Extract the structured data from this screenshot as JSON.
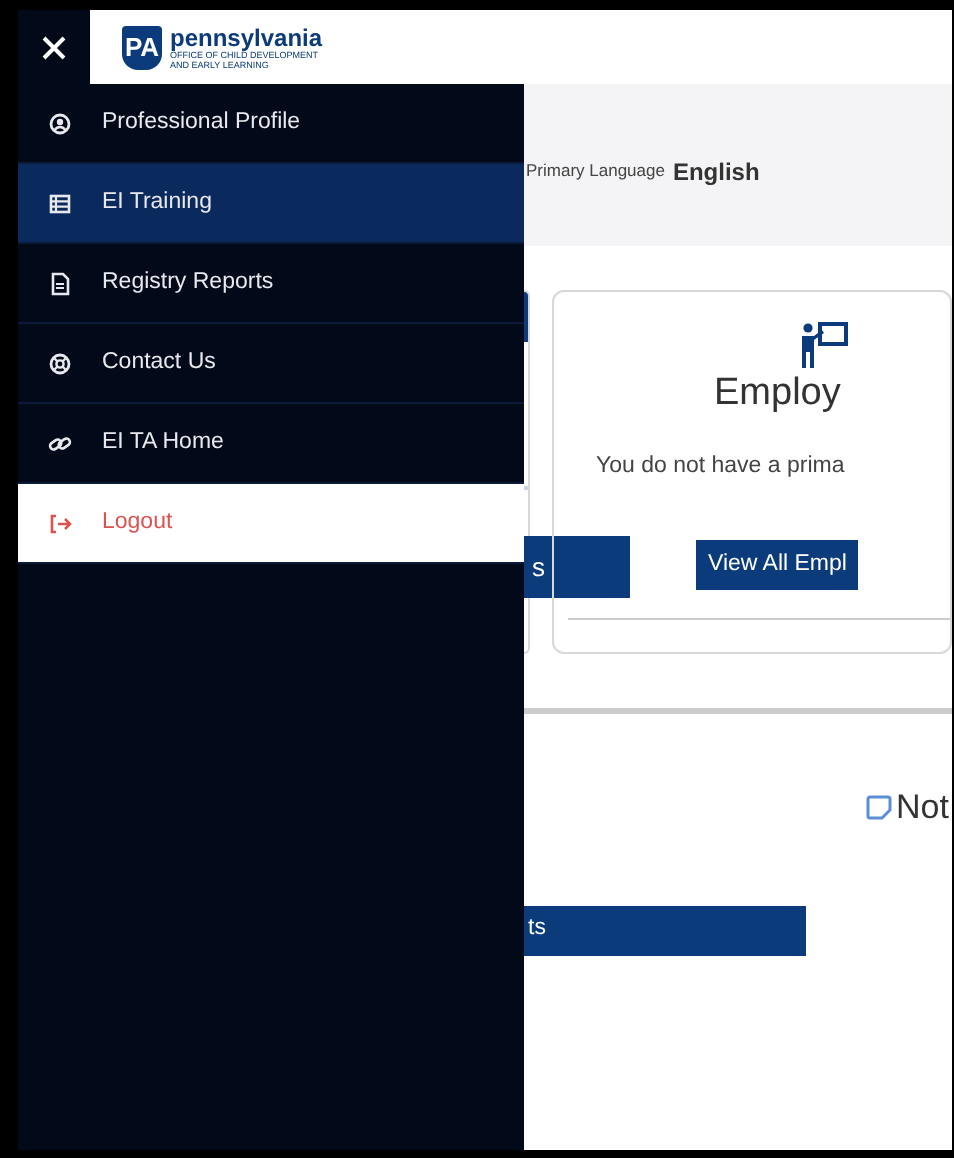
{
  "header": {
    "logo_mark": "PA",
    "logo_name": "pennsylvania",
    "logo_sub": [
      "OFFICE OF CHILD DEVELOPMENT",
      "AND EARLY LEARNING"
    ]
  },
  "menu": [
    {
      "label": "Professional Profile",
      "kind": "link",
      "selected": false
    },
    {
      "label": "EI Training",
      "kind": "link",
      "selected": true
    },
    {
      "label": "Registry Reports",
      "kind": "link",
      "selected": false
    },
    {
      "label": "Contact Us",
      "kind": "link",
      "selected": false
    },
    {
      "label": "EI TA Home",
      "kind": "link",
      "selected": false
    },
    {
      "label": "Logout",
      "kind": "logout",
      "selected": false
    }
  ],
  "profile": {
    "label": "Primary Language",
    "value": "English"
  },
  "left_card": {
    "button": "s"
  },
  "employment_card": {
    "title": "Employ",
    "text": "You do not have a prima",
    "button": "View All Empl"
  },
  "notes": {
    "title": "Not",
    "button": "ts"
  }
}
